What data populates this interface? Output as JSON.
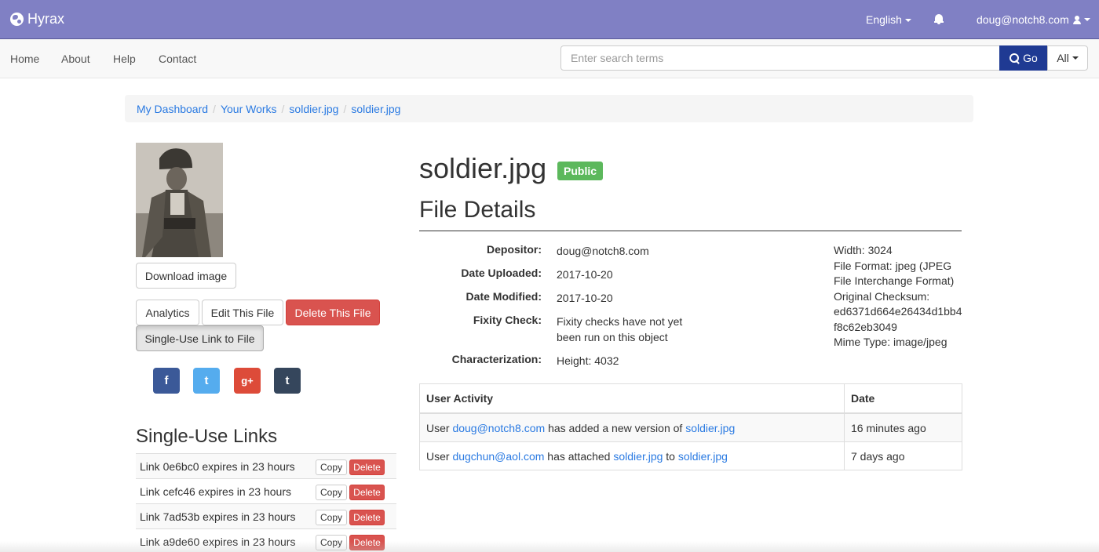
{
  "topbar": {
    "brand": "Hyrax",
    "language": "English",
    "user": "doug@notch8.com"
  },
  "nav": {
    "items": [
      "Home",
      "About",
      "Help",
      "Contact"
    ],
    "search_placeholder": "Enter search terms",
    "go_label": "Go",
    "scope_label": "All"
  },
  "breadcrumb": [
    "My Dashboard",
    "Your Works",
    "soldier.jpg",
    "soldier.jpg"
  ],
  "sidebar": {
    "download_label": "Download image",
    "analytics_label": "Analytics",
    "edit_label": "Edit This File",
    "delete_label": "Delete This File",
    "single_use_label": "Single-Use Link to File",
    "social": [
      {
        "name": "facebook",
        "glyph": "f",
        "color": "#3b5998"
      },
      {
        "name": "twitter",
        "glyph": "t",
        "color": "#55acee"
      },
      {
        "name": "google-plus",
        "glyph": "g+",
        "color": "#dd4b39"
      },
      {
        "name": "tumblr",
        "glyph": "t",
        "color": "#35465c"
      }
    ],
    "single_use_heading": "Single-Use Links",
    "copy_label": "Copy",
    "delete_small_label": "Delete",
    "links": [
      "Link 0e6bc0 expires in 23 hours",
      "Link cefc46 expires in 23 hours",
      "Link 7ad53b expires in 23 hours",
      "Link a9de60 expires in 23 hours"
    ]
  },
  "main": {
    "title": "soldier.jpg",
    "visibility": "Public",
    "details_heading": "File Details",
    "fields": {
      "depositor_label": "Depositor:",
      "depositor_value": "doug@notch8.com",
      "uploaded_label": "Date Uploaded:",
      "uploaded_value": "2017-10-20",
      "modified_label": "Date Modified:",
      "modified_value": "2017-10-20",
      "fixity_label": "Fixity Check:",
      "fixity_value_1": "Fixity checks have not yet",
      "fixity_value_2": "been run on this object",
      "char_label": "Characterization:",
      "char_height": "Height: 4032"
    },
    "characterization": [
      "Width: 3024",
      "File Format: jpeg (JPEG",
      "File Interchange Format)",
      "Original Checksum:",
      "ed6371d664e26434d1bb4",
      "f8c62eb3049",
      "Mime Type: image/jpeg"
    ],
    "activity": {
      "col_activity": "User Activity",
      "col_date": "Date",
      "rows": [
        {
          "prefix": "User",
          "user": "doug@notch8.com",
          "action": "has added a new version of",
          "target": "soldier.jpg",
          "date": "16 minutes ago"
        },
        {
          "prefix": "User",
          "user": "dugchun@aol.com",
          "action": "has attached",
          "target": "soldier.jpg",
          "connector": "to",
          "target2": "soldier.jpg",
          "date": "7 days ago"
        }
      ]
    }
  }
}
